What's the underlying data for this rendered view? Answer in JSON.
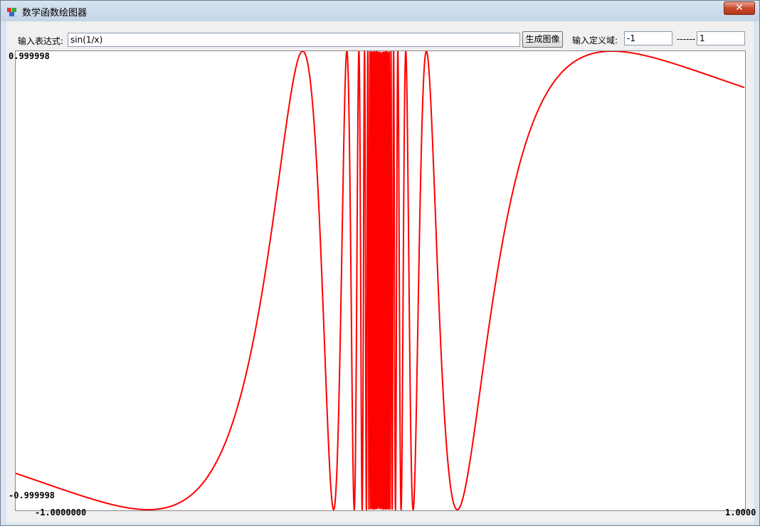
{
  "window": {
    "title": "数学函数绘图器",
    "close_label": "✕"
  },
  "toolbar": {
    "expression_label": "输入表达式:",
    "expression_value": "sin(1/x)",
    "generate_button": "生成图像",
    "domain_label": "输入定义域:",
    "domain_min": "-1",
    "domain_separator": "------",
    "domain_max": "1"
  },
  "chart_data": {
    "type": "line",
    "function": "sin(1/x)",
    "xlim": [
      -1,
      1
    ],
    "ylim": [
      -0.999998,
      0.999998
    ],
    "y_max_label": "0.999998",
    "y_min_label": "-0.999998",
    "x_min_label": "-1.0000000",
    "x_max_label": "1.0000",
    "line_color": "#ff0000",
    "grid": false
  }
}
